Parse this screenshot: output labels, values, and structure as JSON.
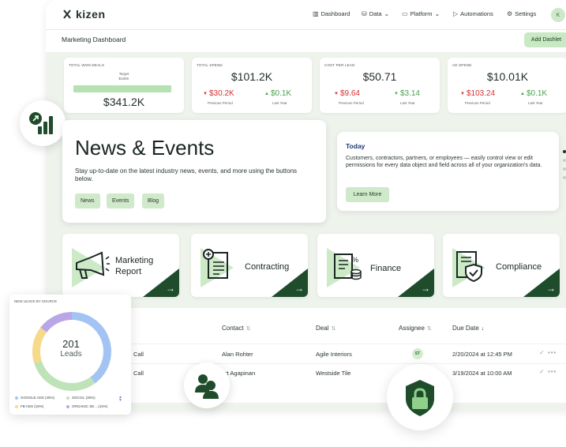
{
  "app": {
    "brand": "kizen"
  },
  "nav": {
    "dashboard": "Dashboard",
    "data": "Data",
    "platform": "Platform",
    "automations": "Automations",
    "settings": "Settings",
    "avatar_initial": "K"
  },
  "page": {
    "title": "Marketing Dashboard",
    "add_dashlet": "Add Dashlet"
  },
  "kpis": {
    "won": {
      "label": "TOTAL WON DEALS",
      "target_label": "Target",
      "target_value": "$160K",
      "progress": 1.0,
      "value": "$341.2K"
    },
    "spend": {
      "label": "TOTAL SPEND",
      "value": "$101.2K",
      "prev": "$30.2K",
      "prev_cap": "Previous Period",
      "last": "$0.1K",
      "last_cap": "Last Year"
    },
    "cpl": {
      "label": "COST PER LEAD",
      "value": "$50.71",
      "prev": "$9.64",
      "prev_cap": "Previous Period",
      "last": "$3.14",
      "last_cap": "Last Year"
    },
    "ad": {
      "label": "AD SPEND",
      "value": "$10.01K",
      "prev": "$103.24",
      "prev_cap": "Previous Period",
      "last": "$0.1K",
      "last_cap": "Last Year"
    }
  },
  "news": {
    "title": "News & Events",
    "description": "Stay up-to-date on the latest industry news, events, and more using the buttons below.",
    "chips": [
      "News",
      "Events",
      "Blog"
    ]
  },
  "today": {
    "title": "Today",
    "description": "Customers, contractors, partners, or employees — easily control view or edit permissions for every data object and field across all of your organization's data.",
    "button": "Learn More"
  },
  "tiles": [
    {
      "label": "Marketing Report",
      "line1": "Marketing",
      "line2": "Report",
      "icon": "megaphone-icon"
    },
    {
      "label": "Contracting",
      "icon": "contract-icon"
    },
    {
      "label": "Finance",
      "icon": "finance-icon"
    },
    {
      "label": "Compliance",
      "icon": "compliance-icon"
    }
  ],
  "table": {
    "headers": {
      "contact": "Contact",
      "deal": "Deal",
      "assignee": "Assignee",
      "due": "Due Date"
    },
    "rows": [
      {
        "type": "Call",
        "contact": "Alan Rohter",
        "deal": "Agile Interiors",
        "assignee": "ST",
        "due": "2/20/2024 at 12:45 PM"
      },
      {
        "type": "Call",
        "contact": "ort Agapinan",
        "deal": "Westside Tile",
        "assignee": "",
        "due": "3/19/2024 at 10:00 AM"
      }
    ]
  },
  "leads": {
    "title": "NEW LEADS BY SOURCE",
    "total": "201",
    "unit": "Leads",
    "legend": [
      {
        "label": "GOOGLE ADS (40%)",
        "color": "#a3c4f3"
      },
      {
        "label": "SOCIAL (30%)",
        "color": "#bfe3b8"
      },
      {
        "label": "FB ADS (15%)",
        "color": "#f6d98a"
      },
      {
        "label": "ORGANIC SE... (15%)",
        "color": "#b9a6e6"
      }
    ]
  },
  "colors": {
    "accent": "#1f4d2c",
    "light_green": "#cfe9ca",
    "down": "#d2302f",
    "up": "#4aa352",
    "today_title": "#1c3a72"
  }
}
